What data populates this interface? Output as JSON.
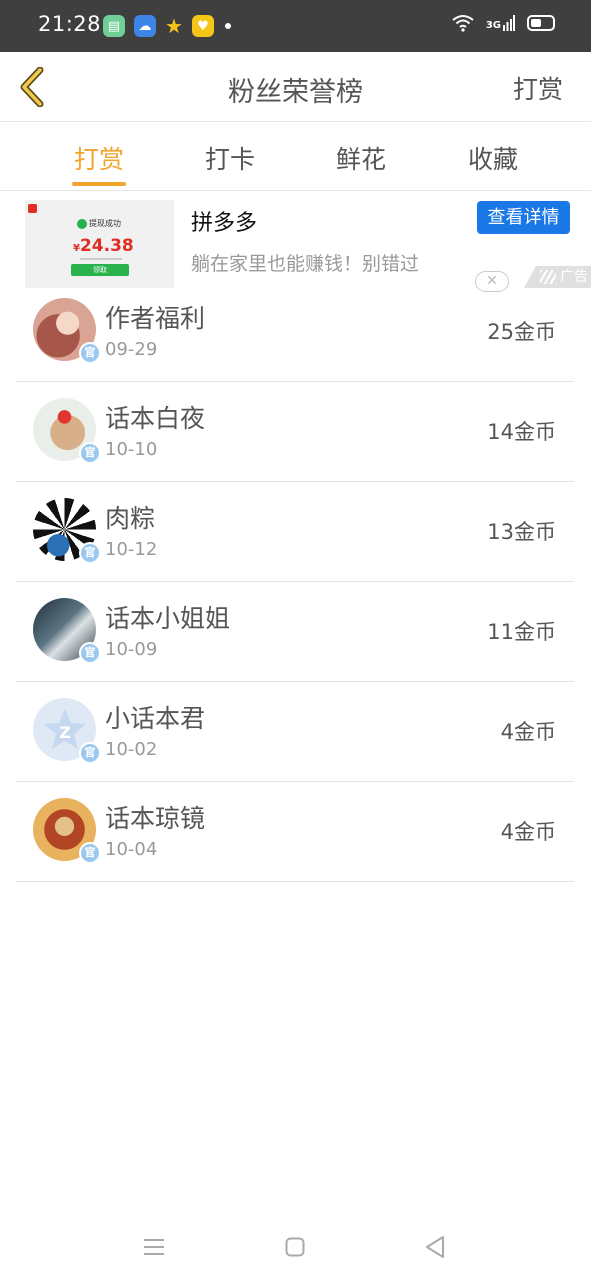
{
  "status_bar": {
    "time": "21:28",
    "network": "3G"
  },
  "header": {
    "title": "粉丝荣誉榜",
    "action": "打赏"
  },
  "tabs": [
    {
      "label": "打赏",
      "active": true
    },
    {
      "label": "打卡",
      "active": false
    },
    {
      "label": "鲜花",
      "active": false
    },
    {
      "label": "收藏",
      "active": false
    }
  ],
  "ad": {
    "title": "拼多多",
    "description": "躺在家里也能赚钱！别错过",
    "cta": "查看详情",
    "badge": "广告",
    "image_text": "提现成功",
    "image_amount": "24.38",
    "image_currency": "¥",
    "image_button": "领取"
  },
  "fans": [
    {
      "name": "作者福利",
      "date": "09-29",
      "amount": "25金币",
      "badge": "官"
    },
    {
      "name": "话本白夜",
      "date": "10-10",
      "amount": "14金币",
      "badge": "官"
    },
    {
      "name": "肉粽",
      "date": "10-12",
      "amount": "13金币",
      "badge": "官"
    },
    {
      "name": "话本小姐姐",
      "date": "10-09",
      "amount": "11金币",
      "badge": "官"
    },
    {
      "name": "小话本君",
      "date": "10-02",
      "amount": "4金币",
      "badge": "官"
    },
    {
      "name": "话本琼镜",
      "date": "10-04",
      "amount": "4金币",
      "badge": "官"
    }
  ],
  "colors": {
    "accent": "#f2a428",
    "ad_button": "#1a78e6",
    "status_bar": "#3f3f3f"
  }
}
